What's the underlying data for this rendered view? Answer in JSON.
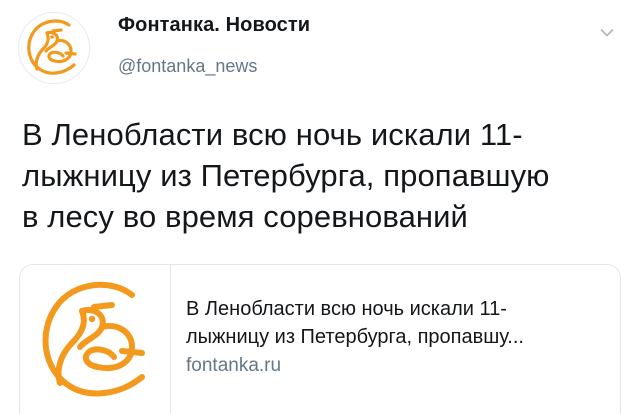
{
  "account": {
    "name": "Фонтанка. Новости",
    "handle": "@fontanka_news",
    "avatar_icon": "fontanka-bird-logo-icon"
  },
  "menu": {
    "icon": "chevron-down-icon"
  },
  "tweet": {
    "text": "В Ленобласти всю ночь искали 11-\nлыжницу из Петербурга, пропавшую\nв лесу во время соревнований"
  },
  "card": {
    "title": "В Ленобласти всю ночь искали 11-\nлыжницу из Петербурга, пропавшу...",
    "domain": "fontanka.ru",
    "thumbnail_icon": "fontanka-bird-logo-icon"
  },
  "colors": {
    "brand_orange": "#f39a1e",
    "text_primary": "#14171a",
    "text_secondary": "#657786",
    "border": "#e1e8ed"
  }
}
